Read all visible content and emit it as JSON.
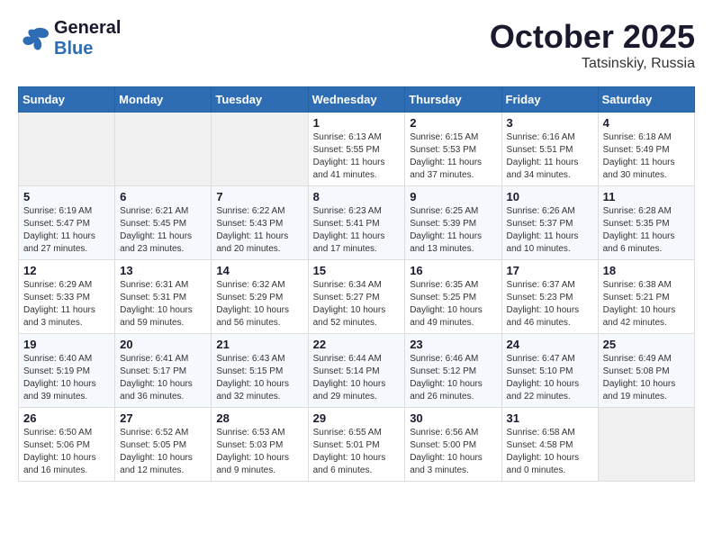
{
  "header": {
    "logo_general": "General",
    "logo_blue": "Blue",
    "month_title": "October 2025",
    "location": "Tatsinskiy, Russia"
  },
  "weekdays": [
    "Sunday",
    "Monday",
    "Tuesday",
    "Wednesday",
    "Thursday",
    "Friday",
    "Saturday"
  ],
  "weeks": [
    [
      {
        "day": "",
        "info": ""
      },
      {
        "day": "",
        "info": ""
      },
      {
        "day": "",
        "info": ""
      },
      {
        "day": "1",
        "info": "Sunrise: 6:13 AM\nSunset: 5:55 PM\nDaylight: 11 hours\nand 41 minutes."
      },
      {
        "day": "2",
        "info": "Sunrise: 6:15 AM\nSunset: 5:53 PM\nDaylight: 11 hours\nand 37 minutes."
      },
      {
        "day": "3",
        "info": "Sunrise: 6:16 AM\nSunset: 5:51 PM\nDaylight: 11 hours\nand 34 minutes."
      },
      {
        "day": "4",
        "info": "Sunrise: 6:18 AM\nSunset: 5:49 PM\nDaylight: 11 hours\nand 30 minutes."
      }
    ],
    [
      {
        "day": "5",
        "info": "Sunrise: 6:19 AM\nSunset: 5:47 PM\nDaylight: 11 hours\nand 27 minutes."
      },
      {
        "day": "6",
        "info": "Sunrise: 6:21 AM\nSunset: 5:45 PM\nDaylight: 11 hours\nand 23 minutes."
      },
      {
        "day": "7",
        "info": "Sunrise: 6:22 AM\nSunset: 5:43 PM\nDaylight: 11 hours\nand 20 minutes."
      },
      {
        "day": "8",
        "info": "Sunrise: 6:23 AM\nSunset: 5:41 PM\nDaylight: 11 hours\nand 17 minutes."
      },
      {
        "day": "9",
        "info": "Sunrise: 6:25 AM\nSunset: 5:39 PM\nDaylight: 11 hours\nand 13 minutes."
      },
      {
        "day": "10",
        "info": "Sunrise: 6:26 AM\nSunset: 5:37 PM\nDaylight: 11 hours\nand 10 minutes."
      },
      {
        "day": "11",
        "info": "Sunrise: 6:28 AM\nSunset: 5:35 PM\nDaylight: 11 hours\nand 6 minutes."
      }
    ],
    [
      {
        "day": "12",
        "info": "Sunrise: 6:29 AM\nSunset: 5:33 PM\nDaylight: 11 hours\nand 3 minutes."
      },
      {
        "day": "13",
        "info": "Sunrise: 6:31 AM\nSunset: 5:31 PM\nDaylight: 10 hours\nand 59 minutes."
      },
      {
        "day": "14",
        "info": "Sunrise: 6:32 AM\nSunset: 5:29 PM\nDaylight: 10 hours\nand 56 minutes."
      },
      {
        "day": "15",
        "info": "Sunrise: 6:34 AM\nSunset: 5:27 PM\nDaylight: 10 hours\nand 52 minutes."
      },
      {
        "day": "16",
        "info": "Sunrise: 6:35 AM\nSunset: 5:25 PM\nDaylight: 10 hours\nand 49 minutes."
      },
      {
        "day": "17",
        "info": "Sunrise: 6:37 AM\nSunset: 5:23 PM\nDaylight: 10 hours\nand 46 minutes."
      },
      {
        "day": "18",
        "info": "Sunrise: 6:38 AM\nSunset: 5:21 PM\nDaylight: 10 hours\nand 42 minutes."
      }
    ],
    [
      {
        "day": "19",
        "info": "Sunrise: 6:40 AM\nSunset: 5:19 PM\nDaylight: 10 hours\nand 39 minutes."
      },
      {
        "day": "20",
        "info": "Sunrise: 6:41 AM\nSunset: 5:17 PM\nDaylight: 10 hours\nand 36 minutes."
      },
      {
        "day": "21",
        "info": "Sunrise: 6:43 AM\nSunset: 5:15 PM\nDaylight: 10 hours\nand 32 minutes."
      },
      {
        "day": "22",
        "info": "Sunrise: 6:44 AM\nSunset: 5:14 PM\nDaylight: 10 hours\nand 29 minutes."
      },
      {
        "day": "23",
        "info": "Sunrise: 6:46 AM\nSunset: 5:12 PM\nDaylight: 10 hours\nand 26 minutes."
      },
      {
        "day": "24",
        "info": "Sunrise: 6:47 AM\nSunset: 5:10 PM\nDaylight: 10 hours\nand 22 minutes."
      },
      {
        "day": "25",
        "info": "Sunrise: 6:49 AM\nSunset: 5:08 PM\nDaylight: 10 hours\nand 19 minutes."
      }
    ],
    [
      {
        "day": "26",
        "info": "Sunrise: 6:50 AM\nSunset: 5:06 PM\nDaylight: 10 hours\nand 16 minutes."
      },
      {
        "day": "27",
        "info": "Sunrise: 6:52 AM\nSunset: 5:05 PM\nDaylight: 10 hours\nand 12 minutes."
      },
      {
        "day": "28",
        "info": "Sunrise: 6:53 AM\nSunset: 5:03 PM\nDaylight: 10 hours\nand 9 minutes."
      },
      {
        "day": "29",
        "info": "Sunrise: 6:55 AM\nSunset: 5:01 PM\nDaylight: 10 hours\nand 6 minutes."
      },
      {
        "day": "30",
        "info": "Sunrise: 6:56 AM\nSunset: 5:00 PM\nDaylight: 10 hours\nand 3 minutes."
      },
      {
        "day": "31",
        "info": "Sunrise: 6:58 AM\nSunset: 4:58 PM\nDaylight: 10 hours\nand 0 minutes."
      },
      {
        "day": "",
        "info": ""
      }
    ]
  ]
}
